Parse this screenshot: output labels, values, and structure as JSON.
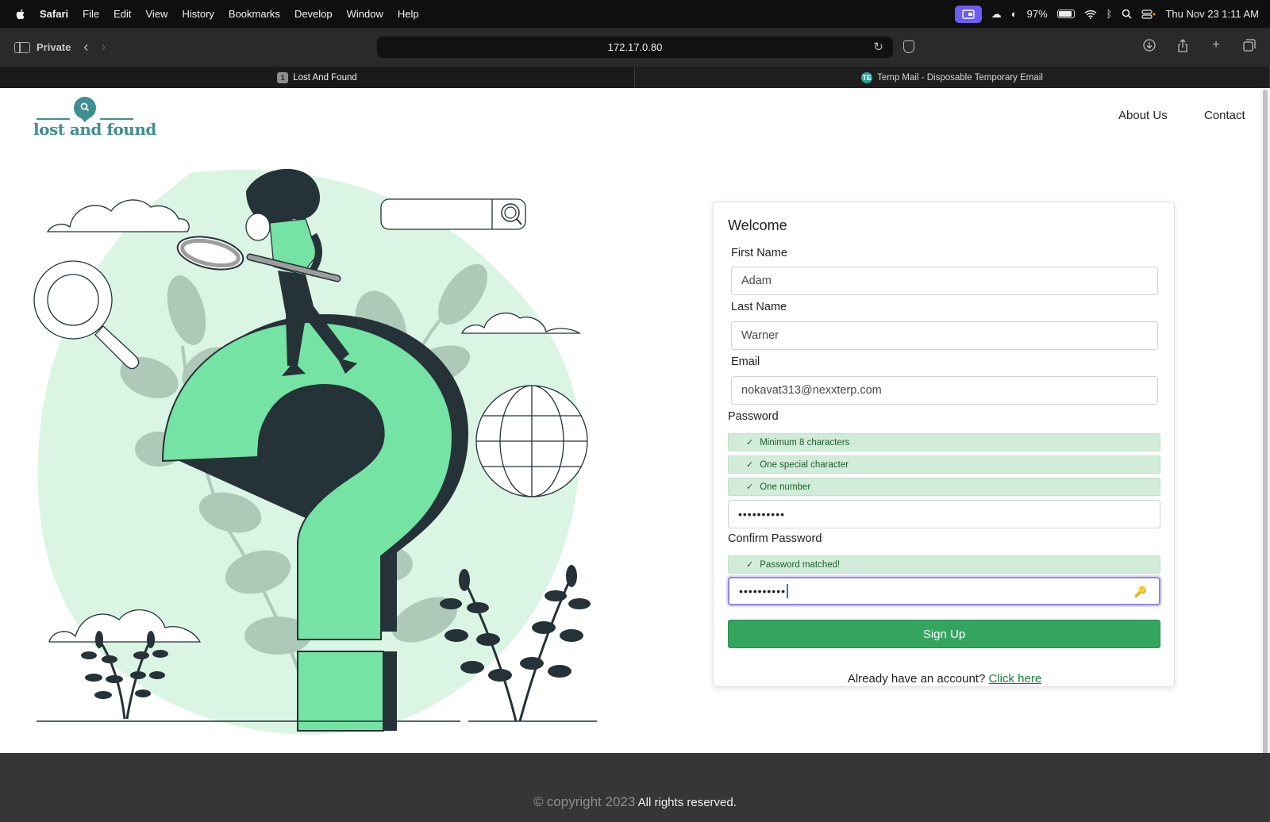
{
  "menubar": {
    "app_name": "Safari",
    "items": [
      "File",
      "Edit",
      "View",
      "History",
      "Bookmarks",
      "Develop",
      "Window",
      "Help"
    ],
    "battery": "97%",
    "datetime": "Thu Nov 23  1:11 AM"
  },
  "toolbar": {
    "private_label": "Private",
    "url": "172.17.0.80"
  },
  "tabs": [
    {
      "label": "Lost And Found",
      "badge": "1"
    },
    {
      "label": "Temp Mail - Disposable Temporary Email",
      "badge": "TE"
    }
  ],
  "site": {
    "logo_text": "lost and found",
    "nav": {
      "about": "About Us",
      "contact": "Contact"
    }
  },
  "form": {
    "title": "Welcome",
    "first_name_label": "First Name",
    "first_name_value": "Adam",
    "last_name_label": "Last Name",
    "last_name_value": "Warner",
    "email_label": "Email",
    "email_value": "nokavat313@nexxterp.com",
    "password_label": "Password",
    "password_checks": [
      "Minimum 8 characters",
      "One special character",
      "One number"
    ],
    "password_mask": "••••••••••",
    "confirm_label": "Confirm Password",
    "confirm_check": "Password matched!",
    "confirm_mask": "••••••••••",
    "signup_label": "Sign Up",
    "already_text": "Already have an account?",
    "login_link": "Click here"
  },
  "footer": {
    "copyright": "copyright 2023",
    "rights": "All rights reserved."
  },
  "colors": {
    "accent_green": "#34a55f",
    "mint": "#daf5e3",
    "qmark": "#75e3a3",
    "logo_teal": "#3f8e92",
    "dark_ink": "#253238"
  }
}
